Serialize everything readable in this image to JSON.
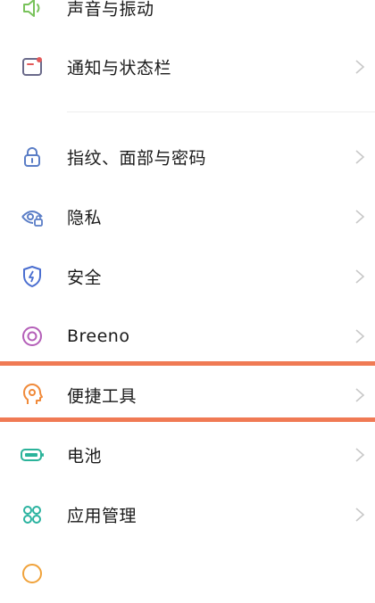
{
  "accent_colors": {
    "sound": "#78c25a",
    "notification": "#e35a5a",
    "lock": "#5a7dc6",
    "privacy": "#5a7dc6",
    "security": "#4a6ed0",
    "breeno": "#b45fb8",
    "tools": "#f08a3a",
    "battery": "#2bb39a",
    "apps": "#2bb3a0",
    "highlight": "#f07a54"
  },
  "settings": {
    "items": [
      {
        "label": "声音与振动",
        "icon": "speaker-icon"
      },
      {
        "label": "通知与状态栏",
        "icon": "notification-icon"
      },
      {
        "label": "指纹、面部与密码",
        "icon": "lock-icon"
      },
      {
        "label": "隐私",
        "icon": "privacy-eye-icon"
      },
      {
        "label": "安全",
        "icon": "shield-icon"
      },
      {
        "label": "Breeno",
        "icon": "breeno-icon"
      },
      {
        "label": "便捷工具",
        "icon": "convenience-tools-icon"
      },
      {
        "label": "电池",
        "icon": "battery-icon"
      },
      {
        "label": "应用管理",
        "icon": "apps-grid-icon"
      }
    ]
  }
}
